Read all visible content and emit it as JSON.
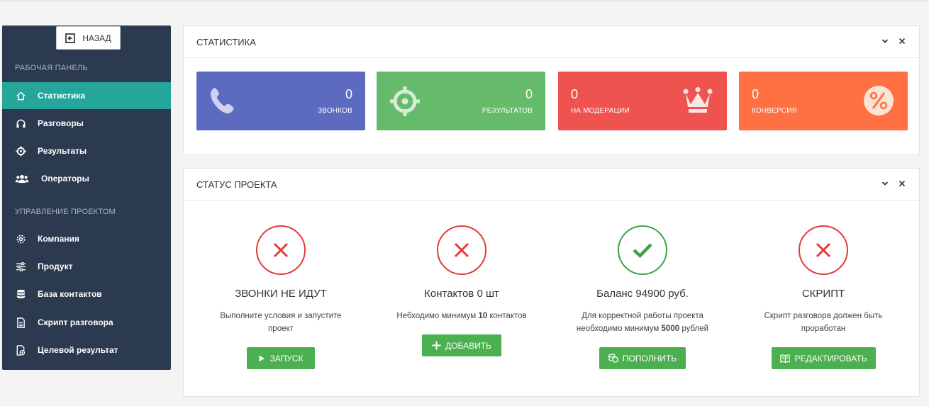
{
  "sidebar": {
    "back_label": "НАЗАД",
    "section_dashboard": "РАБОЧАЯ ПАНЕЛЬ",
    "section_project": "УПРАВЛЕНИЕ ПРОЕКТОМ",
    "items": [
      {
        "label": "Статистика",
        "icon": "home-icon",
        "active": true
      },
      {
        "label": "Разговоры",
        "icon": "headphones-icon"
      },
      {
        "label": "Результаты",
        "icon": "crosshair-icon"
      },
      {
        "label": "Операторы",
        "icon": "users-icon"
      },
      {
        "label": "Компания",
        "icon": "gear-icon"
      },
      {
        "label": "Продукт",
        "icon": "sliders-icon"
      },
      {
        "label": "База контактов",
        "icon": "database-icon"
      },
      {
        "label": "Скрипт разговора",
        "icon": "document-icon"
      },
      {
        "label": "Целевой результат",
        "icon": "target-file-icon"
      }
    ]
  },
  "stats_panel": {
    "title": "СТАТИСТИКА",
    "cards": [
      {
        "value": "0",
        "label": "ЗВОНКОВ",
        "color": "#5c6bc0",
        "icon": "phone-icon"
      },
      {
        "value": "0",
        "label": "РЕЗУЛЬТАТОВ",
        "color": "#66bb6a",
        "icon": "crosshair-icon"
      },
      {
        "value": "0",
        "label": "НА МОДЕРАЦИИ",
        "color": "#ef5350",
        "icon": "crown-icon"
      },
      {
        "value": "0",
        "label": "КОНВЕРСИЯ",
        "color": "#ff7043",
        "icon": "percent-icon"
      }
    ]
  },
  "status_panel": {
    "title": "СТАТУС ПРОЕКТА",
    "items": [
      {
        "status": "error",
        "title": "ЗВОНКИ НЕ ИДУТ",
        "desc_line1": "Выполните условия и запустите",
        "desc_line2": "проект",
        "button": "ЗАПУСК",
        "button_icon": "play-icon"
      },
      {
        "status": "error",
        "title": "Контактов 0 шт",
        "desc_pre": "Небходимо минимум ",
        "desc_bold": "10",
        "desc_post": " контактов",
        "button": "ДОБАВИТЬ",
        "button_icon": "plus-icon"
      },
      {
        "status": "ok",
        "title": "Баланс 94900 руб.",
        "desc_line1": "Для корректной работы проекта",
        "desc_pre": "необходимо минимум ",
        "desc_bold": "5000",
        "desc_post": " рублей",
        "button": "ПОПОЛНИТЬ",
        "button_icon": "coins-icon"
      },
      {
        "status": "error",
        "title": "СКРИПТ",
        "desc_line1": "Скрипт разговора должен быть",
        "desc_line2": "проработан",
        "button": "РЕДАКТИРОВАТЬ",
        "button_icon": "book-icon"
      }
    ]
  },
  "colors": {
    "sidebar": "#2c3a4f",
    "active": "#26a69a",
    "button": "#4caf50",
    "error": "#e53935",
    "ok": "#43a047"
  }
}
